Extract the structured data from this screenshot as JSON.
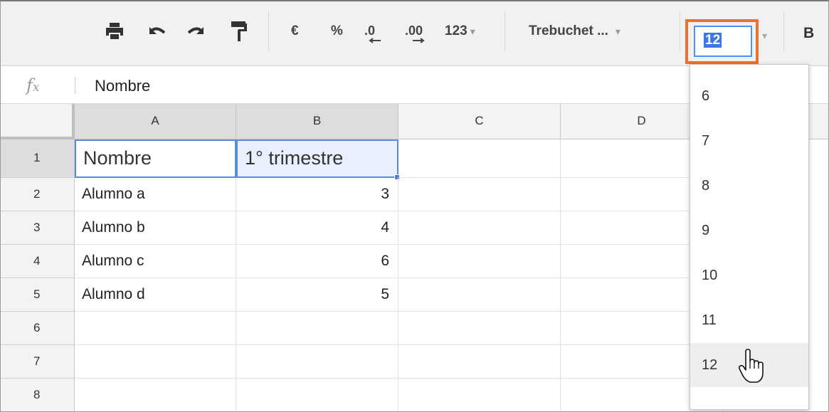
{
  "toolbar": {
    "print_icon": "print-icon",
    "undo_icon": "undo-icon",
    "redo_icon": "redo-icon",
    "paint_format_icon": "paint-format-icon",
    "currency": "€",
    "percent": "%",
    "decrease_decimals": ".0",
    "increase_decimals": ".00",
    "more_formats": "123",
    "font_family": "Trebuchet ...",
    "font_size": "12",
    "bold": "B"
  },
  "formula_bar": {
    "icon": "fx",
    "value": "Nombre"
  },
  "columns": [
    "A",
    "B",
    "C",
    "D"
  ],
  "rows": [
    {
      "num": "1",
      "a": "Nombre",
      "b": "1° trimestre"
    },
    {
      "num": "2",
      "a": "Alumno a",
      "b": "3"
    },
    {
      "num": "3",
      "a": "Alumno b",
      "b": "4"
    },
    {
      "num": "4",
      "a": "Alumno c",
      "b": "6"
    },
    {
      "num": "5",
      "a": "Alumno d",
      "b": "5"
    },
    {
      "num": "6",
      "a": "",
      "b": ""
    },
    {
      "num": "7",
      "a": "",
      "b": ""
    },
    {
      "num": "8",
      "a": "",
      "b": ""
    }
  ],
  "font_size_menu": {
    "options": [
      "6",
      "7",
      "8",
      "9",
      "10",
      "11",
      "12"
    ],
    "hovered": "12"
  },
  "colors": {
    "highlight": "#e97132",
    "selection": "#4d90fe",
    "toolbar_bg": "#f1f1f1"
  }
}
